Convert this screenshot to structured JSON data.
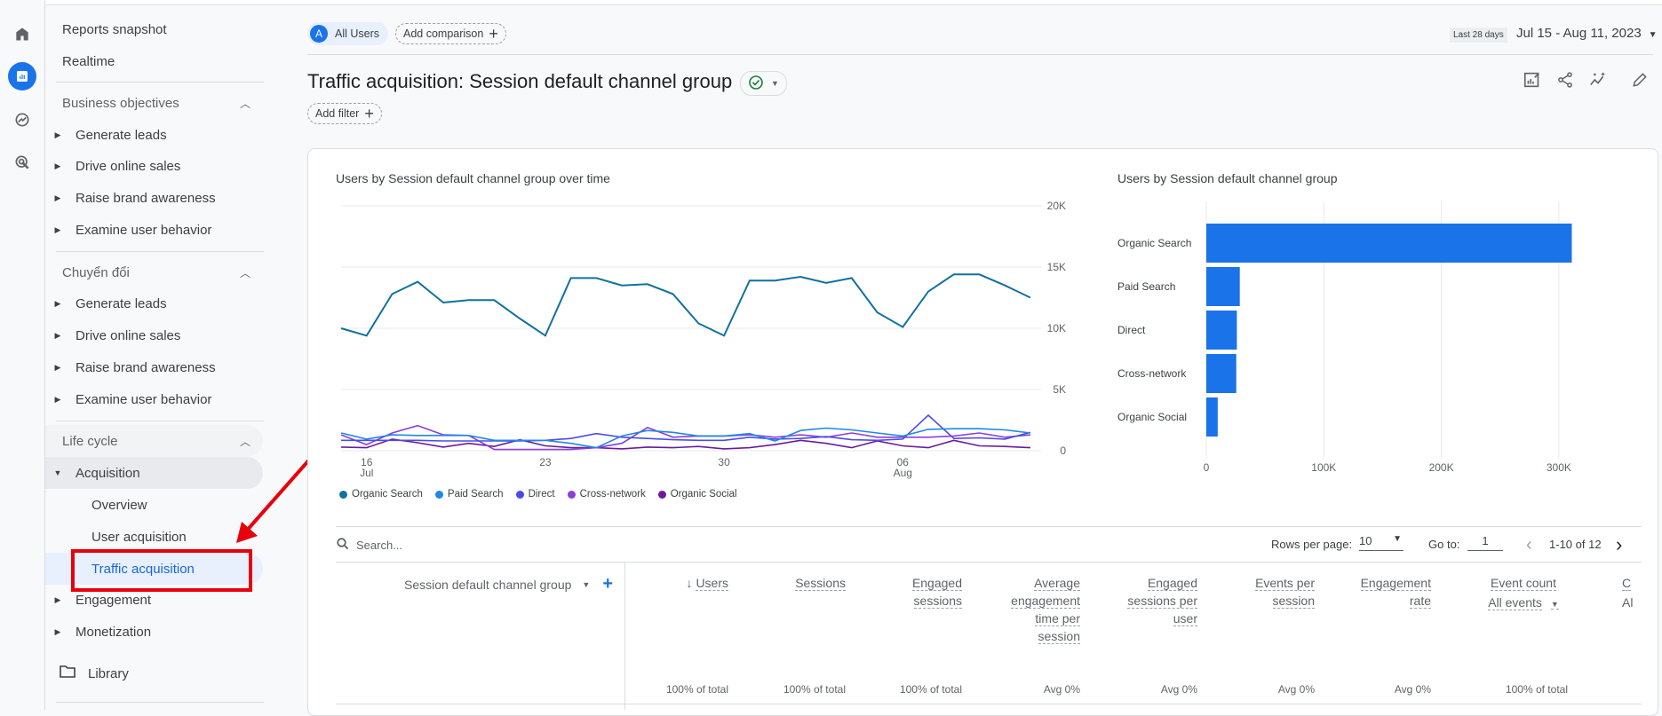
{
  "sidebar": {
    "top": [
      "Reports snapshot",
      "Realtime"
    ],
    "sections": [
      {
        "title": "Business objectives",
        "items": [
          "Generate leads",
          "Drive online sales",
          "Raise brand awareness",
          "Examine user behavior"
        ]
      },
      {
        "title": "Chuyển đổi",
        "items": [
          "Generate leads",
          "Drive online sales",
          "Raise brand awareness",
          "Examine user behavior"
        ]
      },
      {
        "title": "Life cycle",
        "items": [
          "Acquisition",
          "Overview",
          "User acquisition",
          "Traffic acquisition",
          "Engagement",
          "Monetization"
        ]
      }
    ],
    "library": "Library",
    "selected": "Traffic acquisition"
  },
  "header": {
    "segment_badge": "A",
    "segment": "All Users",
    "add_comparison": "Add comparison",
    "date_preset": "Last 28 days",
    "date_range": "Jul 15 - Aug 11, 2023",
    "title": "Traffic acquisition: Session default channel group",
    "add_filter": "Add filter"
  },
  "colors": {
    "accent": "#1a73e8",
    "annotation": "#e8000b"
  },
  "chart_data": [
    {
      "type": "line",
      "title": "Users by Session default channel group over time",
      "x": [
        "Jul 15",
        "Jul 16",
        "Jul 17",
        "Jul 18",
        "Jul 19",
        "Jul 20",
        "Jul 21",
        "Jul 22",
        "Jul 23",
        "Jul 24",
        "Jul 25",
        "Jul 26",
        "Jul 27",
        "Jul 28",
        "Jul 29",
        "Jul 30",
        "Jul 31",
        "Aug 1",
        "Aug 2",
        "Aug 3",
        "Aug 4",
        "Aug 5",
        "Aug 6",
        "Aug 7",
        "Aug 8",
        "Aug 9",
        "Aug 10",
        "Aug 11"
      ],
      "x_ticks": [
        {
          "label": "16",
          "sub": "Jul"
        },
        {
          "label": "23",
          "sub": ""
        },
        {
          "label": "30",
          "sub": ""
        },
        {
          "label": "06",
          "sub": "Aug"
        }
      ],
      "y_ticks": [
        "20K",
        "15K",
        "10K",
        "5K",
        "0"
      ],
      "ylim": [
        0,
        20000
      ],
      "grid": true,
      "legend": "bottom",
      "series": [
        {
          "name": "Organic Search",
          "color": "#12719e",
          "values": [
            10000,
            9400,
            12800,
            13800,
            12100,
            12300,
            12300,
            10800,
            9400,
            14100,
            14100,
            13500,
            13600,
            12800,
            10400,
            9400,
            13900,
            13900,
            14200,
            13700,
            14100,
            11300,
            10100,
            13000,
            14400,
            14400,
            13500,
            12500
          ]
        },
        {
          "name": "Paid Search",
          "color": "#1e88e5",
          "values": [
            1450,
            950,
            1300,
            1250,
            1250,
            1250,
            850,
            850,
            850,
            600,
            250,
            1200,
            1650,
            1500,
            1200,
            1200,
            1400,
            800,
            1650,
            1850,
            1700,
            1450,
            1200,
            1750,
            1800,
            1800,
            1700,
            1450
          ]
        },
        {
          "name": "Direct",
          "color": "#4b4bea",
          "values": [
            850,
            850,
            850,
            850,
            800,
            800,
            800,
            800,
            850,
            1000,
            1400,
            1100,
            1000,
            900,
            850,
            850,
            1100,
            950,
            1000,
            1150,
            900,
            850,
            950,
            2900,
            1000,
            1050,
            950,
            1500
          ]
        },
        {
          "name": "Cross-network",
          "color": "#8b3fd9",
          "values": [
            1300,
            500,
            1450,
            2050,
            1300,
            1250,
            100,
            100,
            100,
            100,
            250,
            600,
            1900,
            1100,
            1200,
            1200,
            1300,
            1100,
            1300,
            1100,
            1450,
            1100,
            1100,
            1100,
            1200,
            1450,
            1100,
            1300
          ]
        },
        {
          "name": "Organic Social",
          "color": "#6a1b9a",
          "values": [
            300,
            250,
            950,
            650,
            300,
            600,
            350,
            900,
            400,
            250,
            250,
            150,
            300,
            250,
            350,
            150,
            250,
            500,
            850,
            600,
            250,
            800,
            400,
            250,
            850,
            400,
            350,
            250
          ]
        }
      ]
    },
    {
      "type": "bar",
      "orientation": "horizontal",
      "title": "Users by Session default channel group",
      "categories": [
        "Organic Search",
        "Paid Search",
        "Direct",
        "Cross-network",
        "Organic Social"
      ],
      "values": [
        311000,
        28500,
        26000,
        25500,
        9700
      ],
      "x_ticks": [
        "0",
        "100K",
        "200K",
        "300K"
      ],
      "xlim": [
        0,
        360000
      ],
      "color": "#1a73e8",
      "grid": true
    }
  ],
  "table": {
    "search_placeholder": "Search...",
    "rows_per_page_label": "Rows per page:",
    "rows_per_page": "10",
    "goto_label": "Go to:",
    "goto_value": "1",
    "page_info": "1-10 of 12",
    "dimension_header": "Session default channel group",
    "columns": [
      {
        "label": "Users",
        "total": "100% of total"
      },
      {
        "label": "Sessions",
        "total": "100% of total"
      },
      {
        "label": "Engaged sessions",
        "total": "100% of total"
      },
      {
        "label": "Average engagement time per session",
        "total": "Avg 0%"
      },
      {
        "label": "Engaged sessions per user",
        "total": "Avg 0%"
      },
      {
        "label": "Events per session",
        "total": "Avg 0%"
      },
      {
        "label": "Engagement rate",
        "total": "Avg 0%"
      },
      {
        "label": "Event count",
        "sub": "All events",
        "total": "100% of total"
      },
      {
        "label": "C",
        "sub": "Al"
      }
    ]
  }
}
